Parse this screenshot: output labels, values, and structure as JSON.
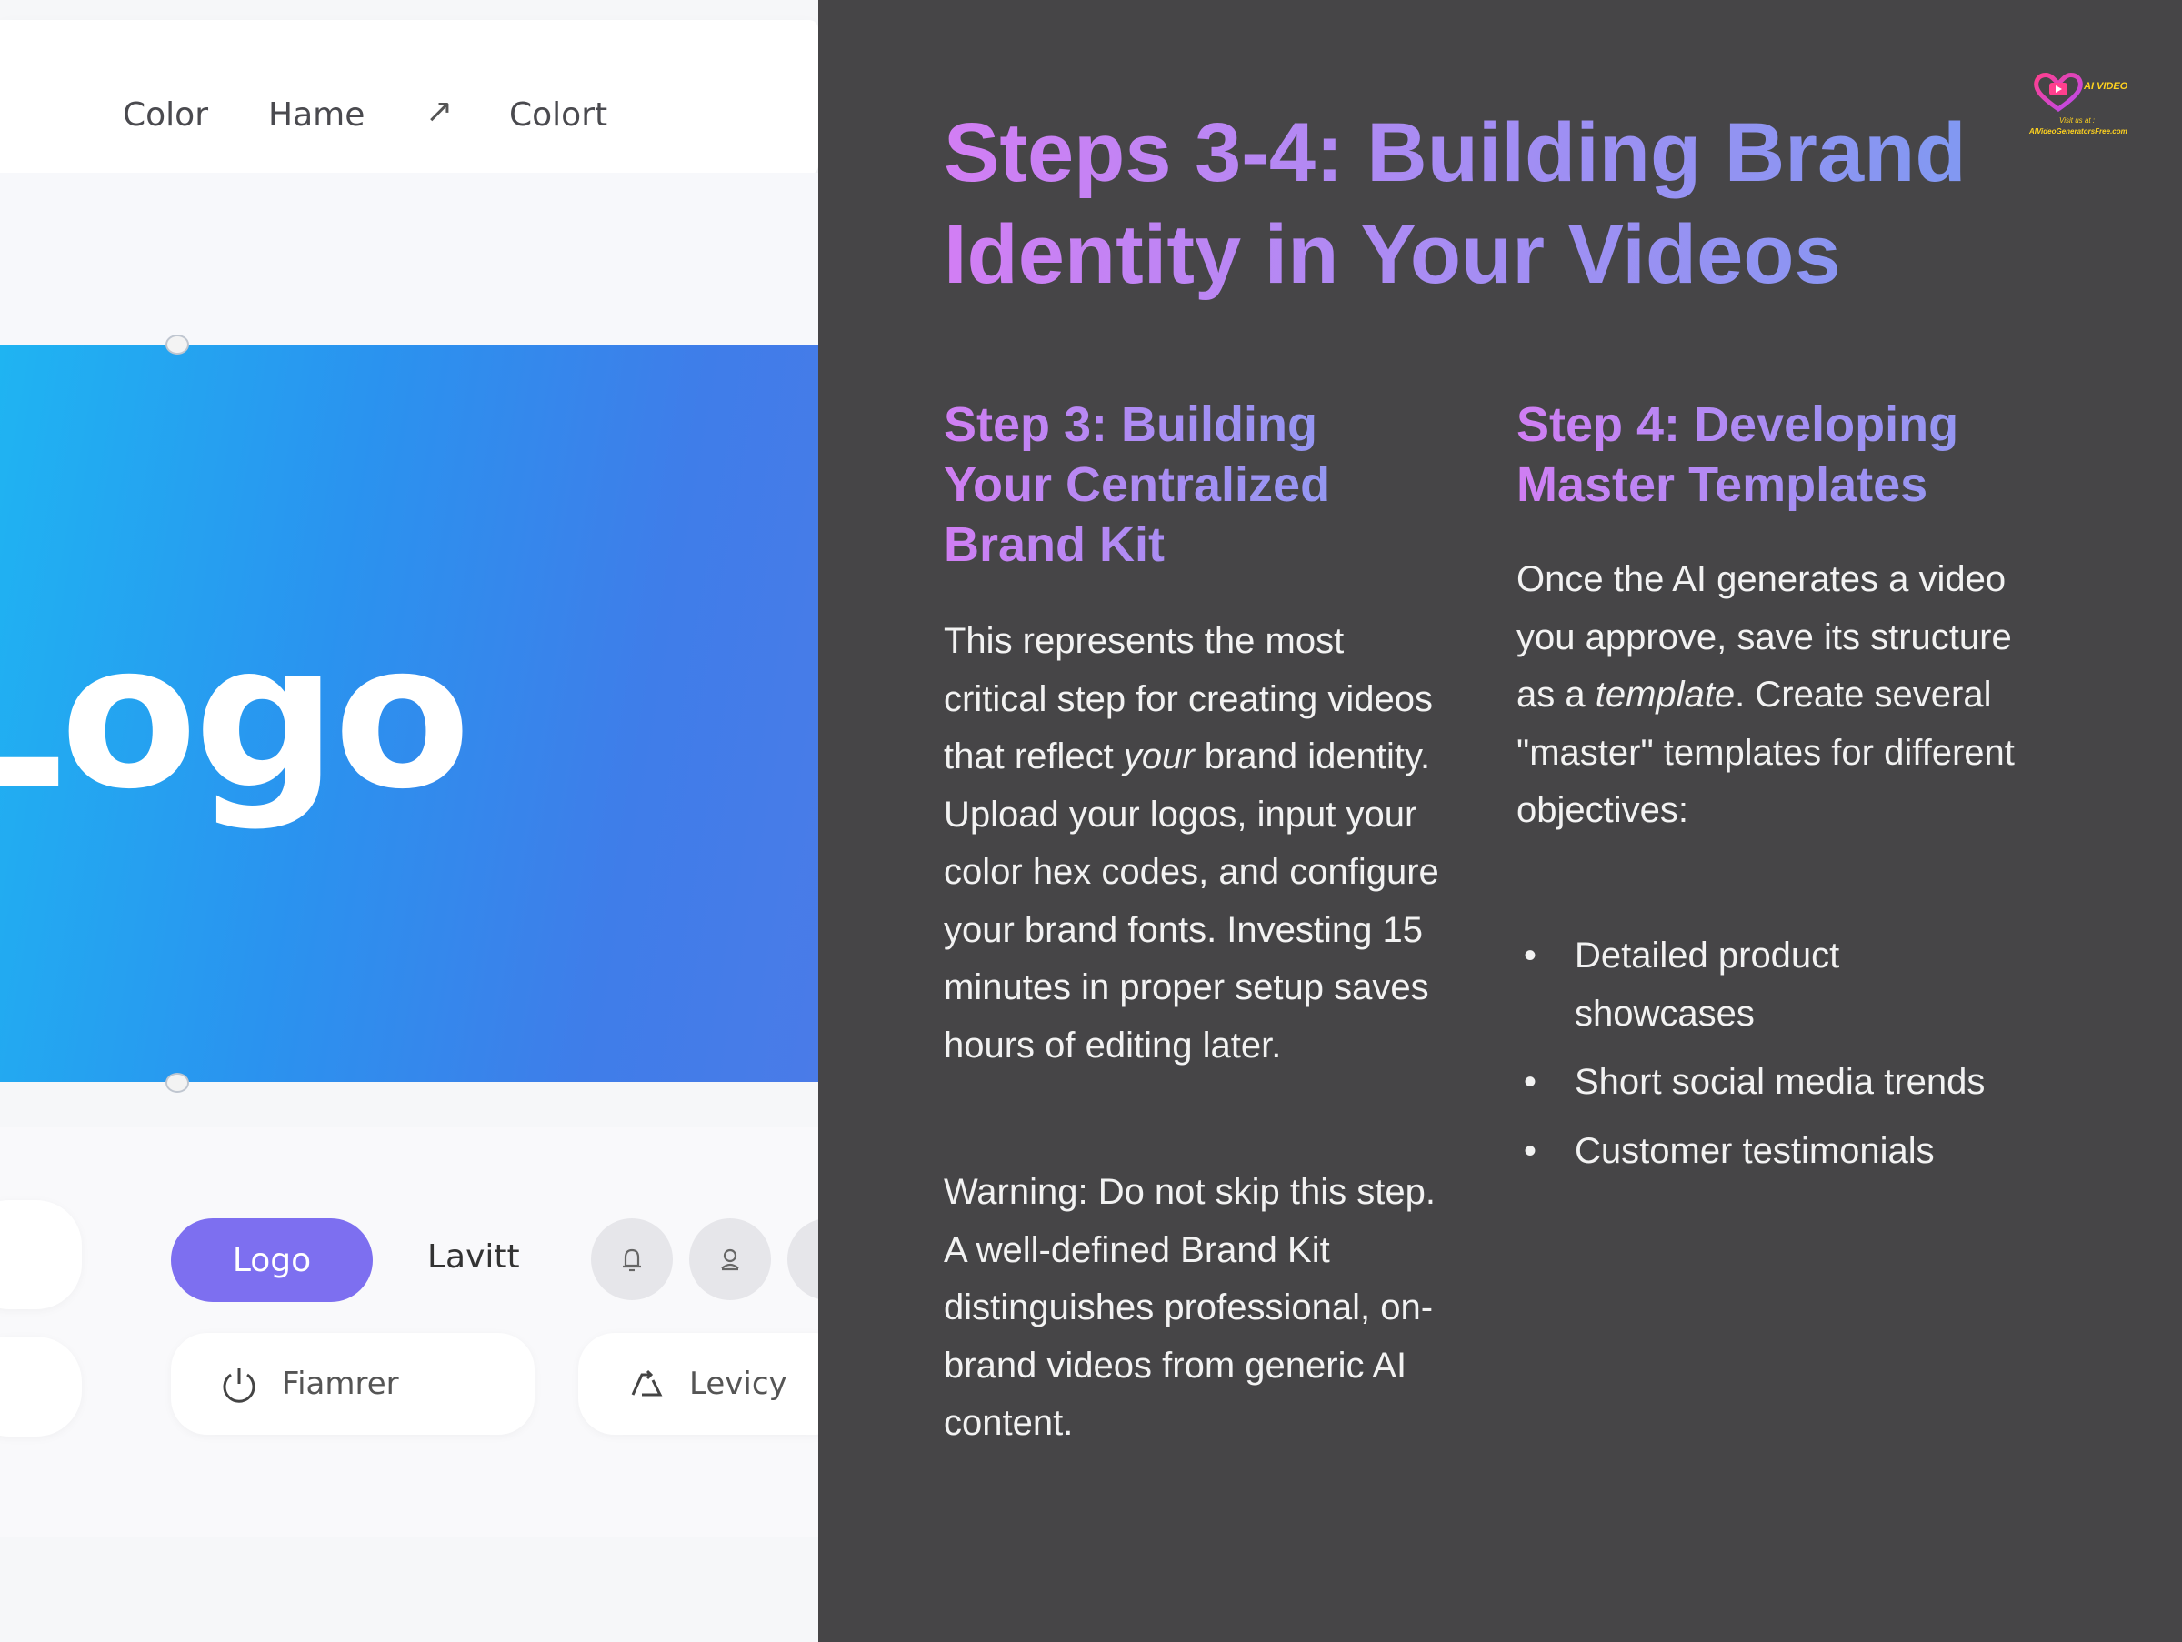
{
  "mockup": {
    "nav": {
      "item1": "Color",
      "item2": "Hame",
      "arrow": "↗",
      "item3": "Colort"
    },
    "banner_text": "Logo",
    "toolbar": {
      "logo_button": "Logo",
      "second_label": "Lavitt",
      "pill1_label": "Fiamrer",
      "pill2_label": "Levicy"
    },
    "colors": {
      "banner_start": "#1fb4f2",
      "banner_end": "#4a7be8",
      "logo_button": "#7d6ff0"
    }
  },
  "slide": {
    "title": "Steps 3-4: Building Brand Identity in Your Videos",
    "step3": {
      "heading": "Step 3: Building Your Centralized Brand Kit",
      "para1_a": "This represents the most critical step for creating videos that reflect ",
      "para1_em": "your",
      "para1_b": " brand identity. Upload your logos, input your color hex codes, and configure your brand fonts. Investing 15 minutes in proper setup saves hours of editing later.",
      "warning": "Warning: Do not skip this step. A well-defined Brand Kit distinguishes professional, on-brand videos from generic AI content."
    },
    "step4": {
      "heading": "Step 4: Developing Master Templates",
      "para_a": "Once the AI generates a video you approve, save its structure as a ",
      "para_em": "template",
      "para_b": ". Create several \"master\" templates for different objectives:",
      "bullets": [
        "Detailed product showcases",
        "Short social media trends",
        "Customer testimonials"
      ]
    },
    "badge": {
      "title": "AI VIDEO",
      "visit": "Visit us at :",
      "url": "AIVideoGeneratorsFree.com"
    },
    "colors": {
      "background": "#464547",
      "gradient_start": "#d27ef4",
      "gradient_end": "#7c9af2",
      "badge_accent": "#ffd21f"
    }
  }
}
